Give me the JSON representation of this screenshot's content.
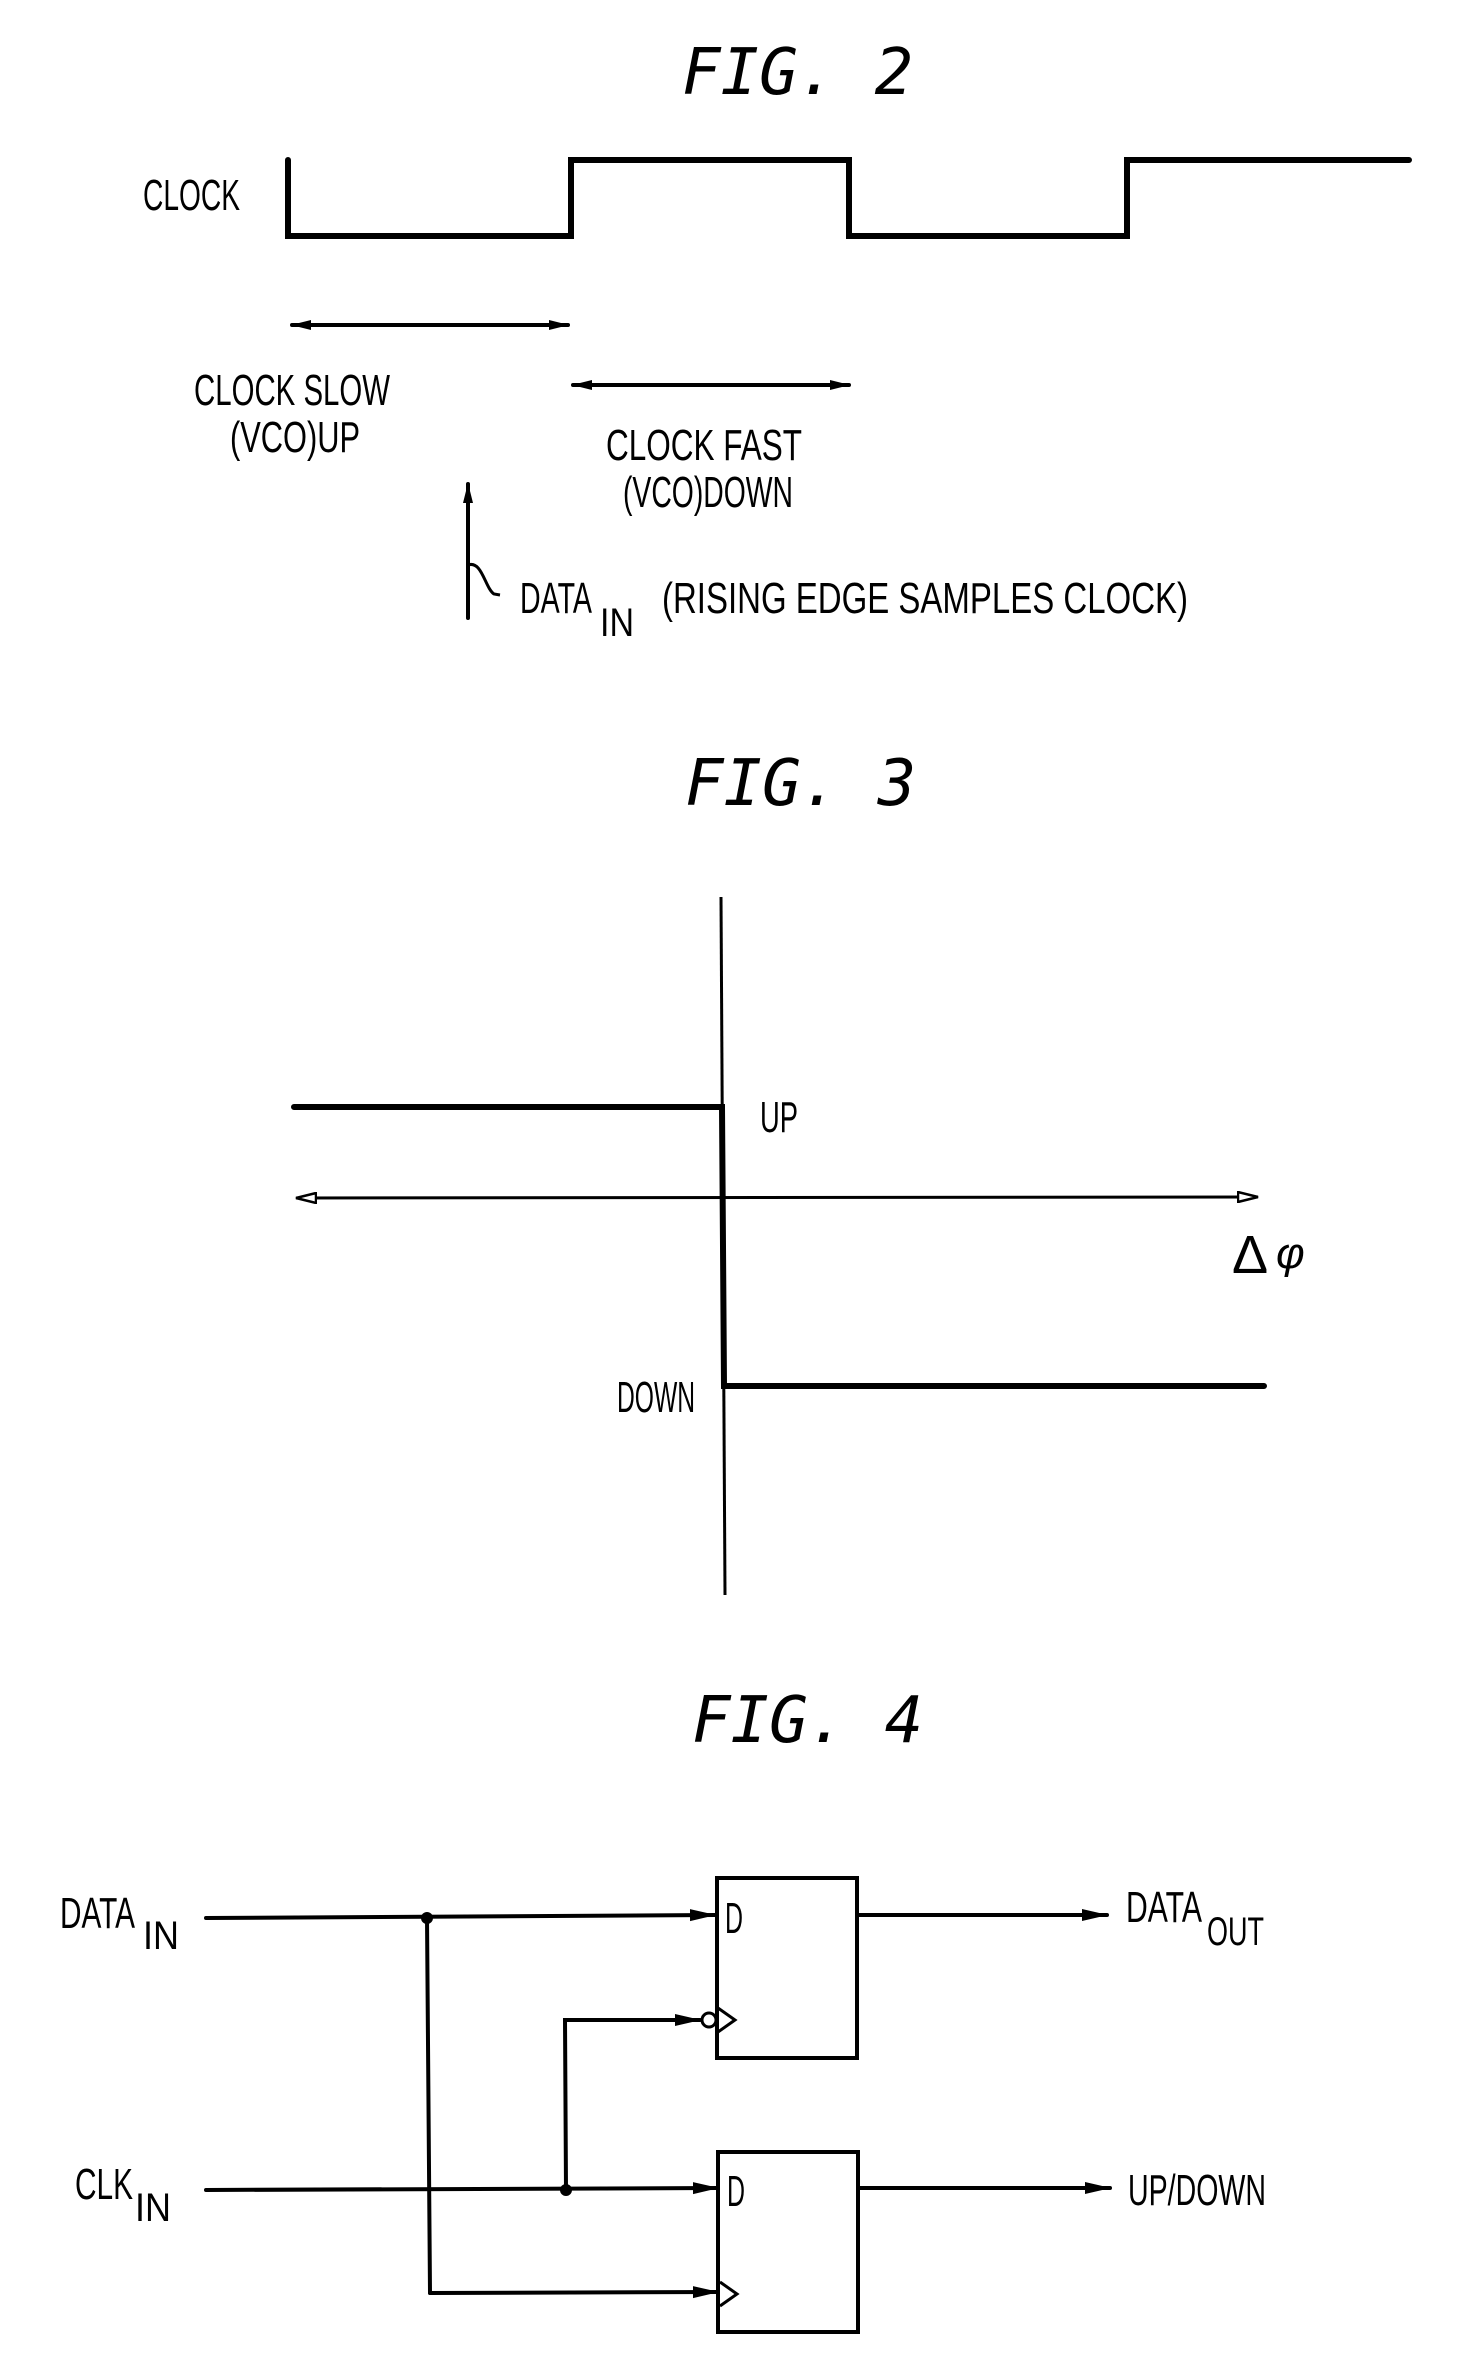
{
  "figures": {
    "fig2": {
      "title": "FIG. 2",
      "signal_label": "CLOCK",
      "slow_label_line1": "CLOCK SLOW",
      "slow_label_line2": "(VCO)UP",
      "fast_label_line1": "CLOCK FAST",
      "fast_label_line2": "(VCO)DOWN",
      "data_label_main": "DATA",
      "data_label_sub": "IN",
      "data_label_note": "(RISING EDGE SAMPLES CLOCK)"
    },
    "fig3": {
      "title": "FIG. 3",
      "up_label": "UP",
      "down_label": "DOWN",
      "axis_label_delta": "Δ",
      "axis_label_phi": "φ"
    },
    "fig4": {
      "title": "FIG. 4",
      "input_data_main": "DATA",
      "input_data_sub": "IN",
      "input_clk_main": "CLK",
      "input_clk_sub": "IN",
      "ff_top_d_label": "D",
      "ff_bottom_d_label": "D",
      "output_data_main": "DATA",
      "output_data_sub": "OUT",
      "output_updown": "UP/DOWN"
    }
  }
}
